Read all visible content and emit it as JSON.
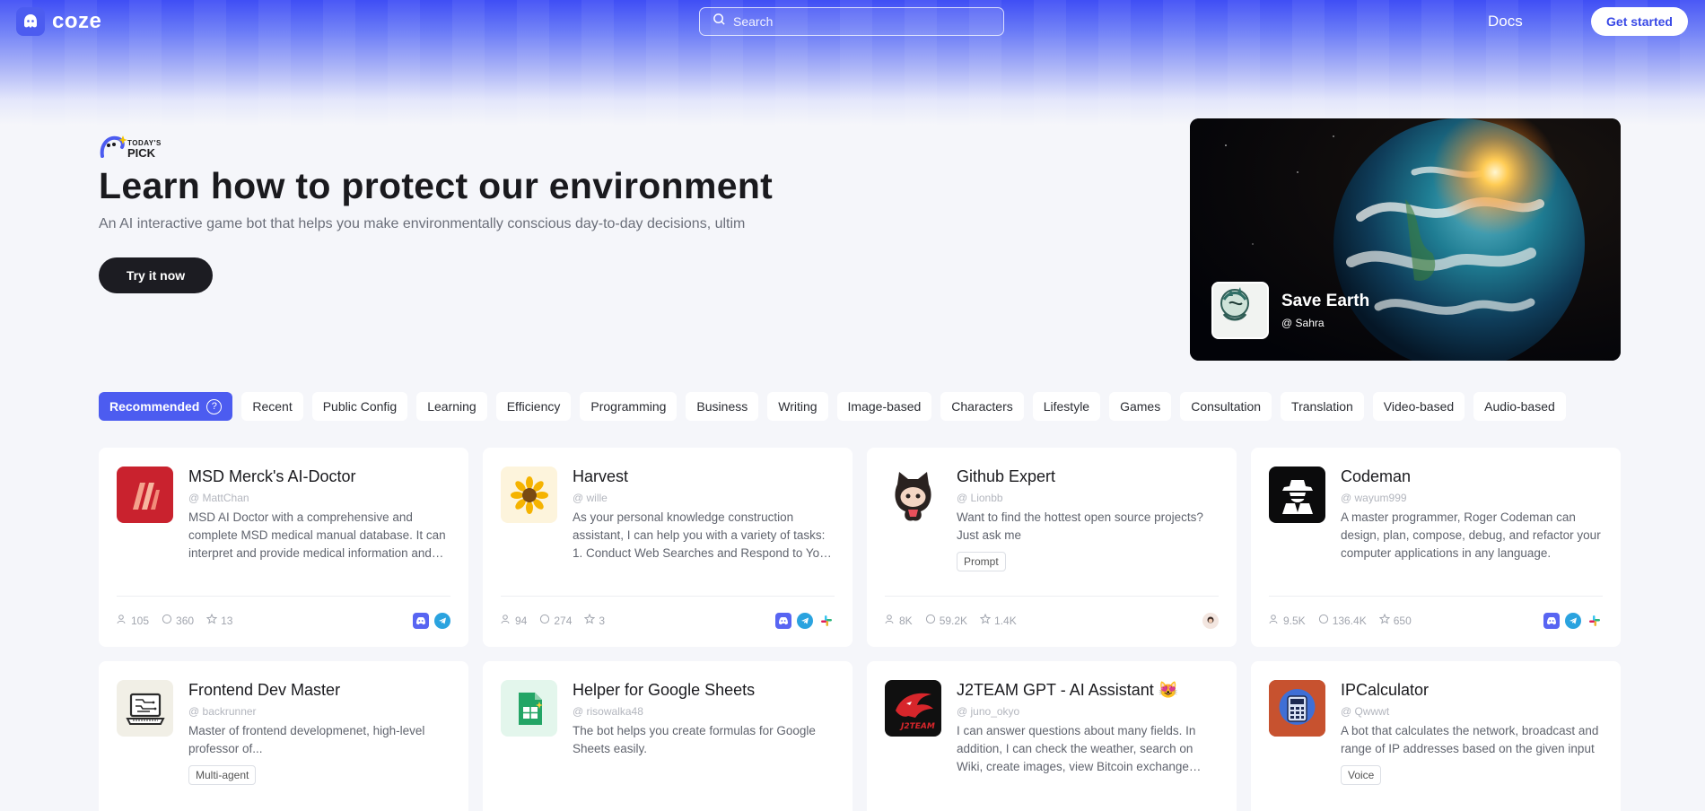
{
  "brand": {
    "name": "coze"
  },
  "search": {
    "placeholder": "Search"
  },
  "nav": {
    "docs": "Docs",
    "get_started": "Get started"
  },
  "hero": {
    "badge_small": "TODAY'S",
    "badge_big": "PICK",
    "title": "Learn how to protect our environment",
    "description": "An AI interactive game bot that helps you make environmentally conscious day-to-day decisions, ultim",
    "cta": "Try it now"
  },
  "featured": {
    "name": "Save Earth",
    "author": "@ Sahra"
  },
  "categories": [
    "Recommended",
    "Recent",
    "Public Config",
    "Learning",
    "Efficiency",
    "Programming",
    "Business",
    "Writing",
    "Image-based",
    "Characters",
    "Lifestyle",
    "Games",
    "Consultation",
    "Translation",
    "Video-based",
    "Audio-based"
  ],
  "category_help": "?",
  "cards": [
    {
      "title": "MSD Merck's AI-Doctor",
      "author": "@ MattChan",
      "description": "MSD AI Doctor with a comprehensive and complete MSD medical manual database. It can interpret and provide medical information and advice",
      "users": "105",
      "messages": "360",
      "favorites": "13",
      "channels": [
        "discord-icon",
        "telegram-icon"
      ]
    },
    {
      "title": "Harvest",
      "author": "@ wille",
      "description": "As your personal knowledge construction assistant, I can help you with a variety of tasks: 1. Conduct Web Searches and Respond to Your Queries",
      "users": "94",
      "messages": "274",
      "favorites": "3",
      "channels": [
        "discord-icon",
        "telegram-icon",
        "slack-icon"
      ]
    },
    {
      "title": "Github Expert",
      "author": "@ Lionbb",
      "description": "Want to find the hottest open source projects? Just ask me",
      "tag": "Prompt",
      "users": "8K",
      "messages": "59.2K",
      "favorites": "1.4K",
      "channels": [
        "user-avatar-icon"
      ]
    },
    {
      "title": "Codeman",
      "author": "@ wayum999",
      "description": "A master programmer, Roger Codeman can design, plan, compose, debug, and refactor your computer applications in any language.",
      "users": "9.5K",
      "messages": "136.4K",
      "favorites": "650",
      "channels": [
        "discord-icon",
        "telegram-icon",
        "slack-icon"
      ]
    },
    {
      "title": "Frontend Dev Master",
      "author": "@ backrunner",
      "description": "Master of frontend developmenet, high-level professor of...",
      "tag": "Multi-agent"
    },
    {
      "title": "Helper for Google Sheets",
      "author": "@ risowalka48",
      "description": "The bot helps you create formulas for Google Sheets easily."
    },
    {
      "title": "J2TEAM GPT - AI Assistant",
      "title_emoji": "😻",
      "author": "@ juno_okyo",
      "description": "I can answer questions about many fields. In addition, I can check the weather, search on Wiki, create images, view Bitcoin exchange rates"
    },
    {
      "title": "IPCalculator",
      "author": "@ Qwwwt",
      "description": "A bot that calculates the network, broadcast and range of IP addresses based on the given input",
      "tag": "Voice"
    }
  ],
  "colors": {
    "accent": "#4c5cf0",
    "dark_button": "#1c1c22",
    "discord": "#5865f2",
    "telegram": "#2aa3df"
  }
}
